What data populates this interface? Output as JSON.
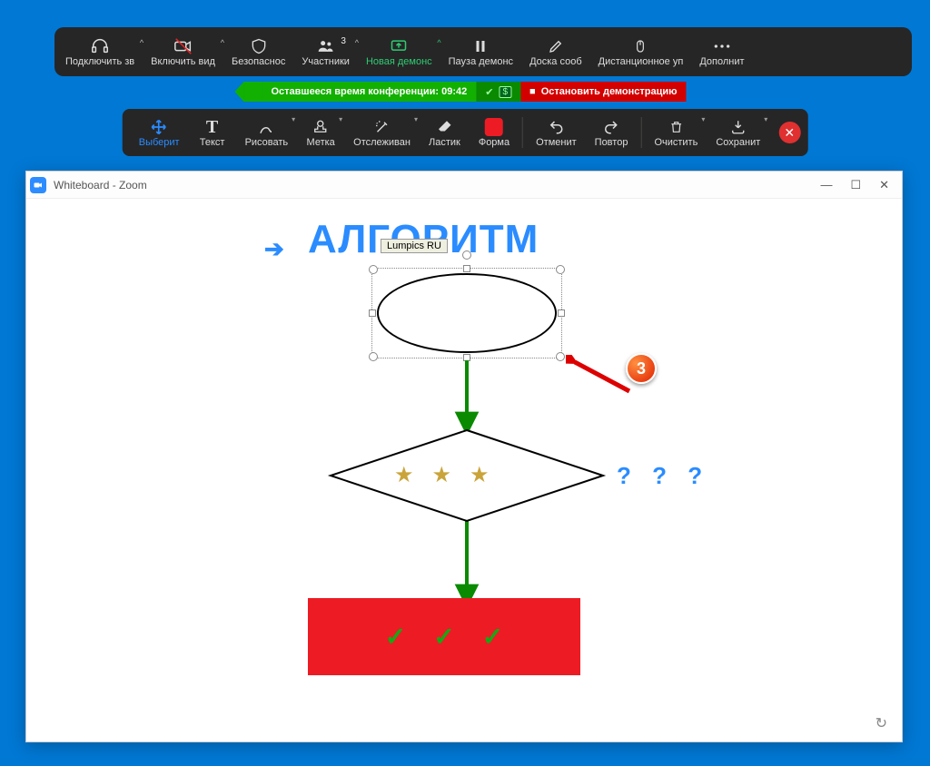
{
  "meeting_bar": {
    "audio": "Подключить зв",
    "video": "Включить вид",
    "security": "Безопаснос",
    "participants": "Участники",
    "participants_count": "3",
    "share": "Новая демонс",
    "pause": "Пауза демонс",
    "whiteboard": "Доска сооб",
    "remote": "Дистанционное уп",
    "more": "Дополнит"
  },
  "banner": {
    "time_remaining": "Оставшееся время конференции: 09:42",
    "stop_share": "Остановить демонстрацию",
    "money_icon": "$"
  },
  "anno": {
    "select": "Выберит",
    "text": "Текст",
    "draw": "Рисовать",
    "stamp": "Метка",
    "spotlight": "Отслеживан",
    "eraser": "Ластик",
    "shape": "Форма",
    "undo": "Отменит",
    "redo": "Повтор",
    "clear": "Очистить",
    "save": "Сохранит"
  },
  "window": {
    "title": "Whiteboard - Zoom"
  },
  "whiteboard": {
    "heading": "АЛГОРИТМ",
    "watermark": "Lumpics RU",
    "questions": "? ? ?",
    "step_number": "3"
  }
}
